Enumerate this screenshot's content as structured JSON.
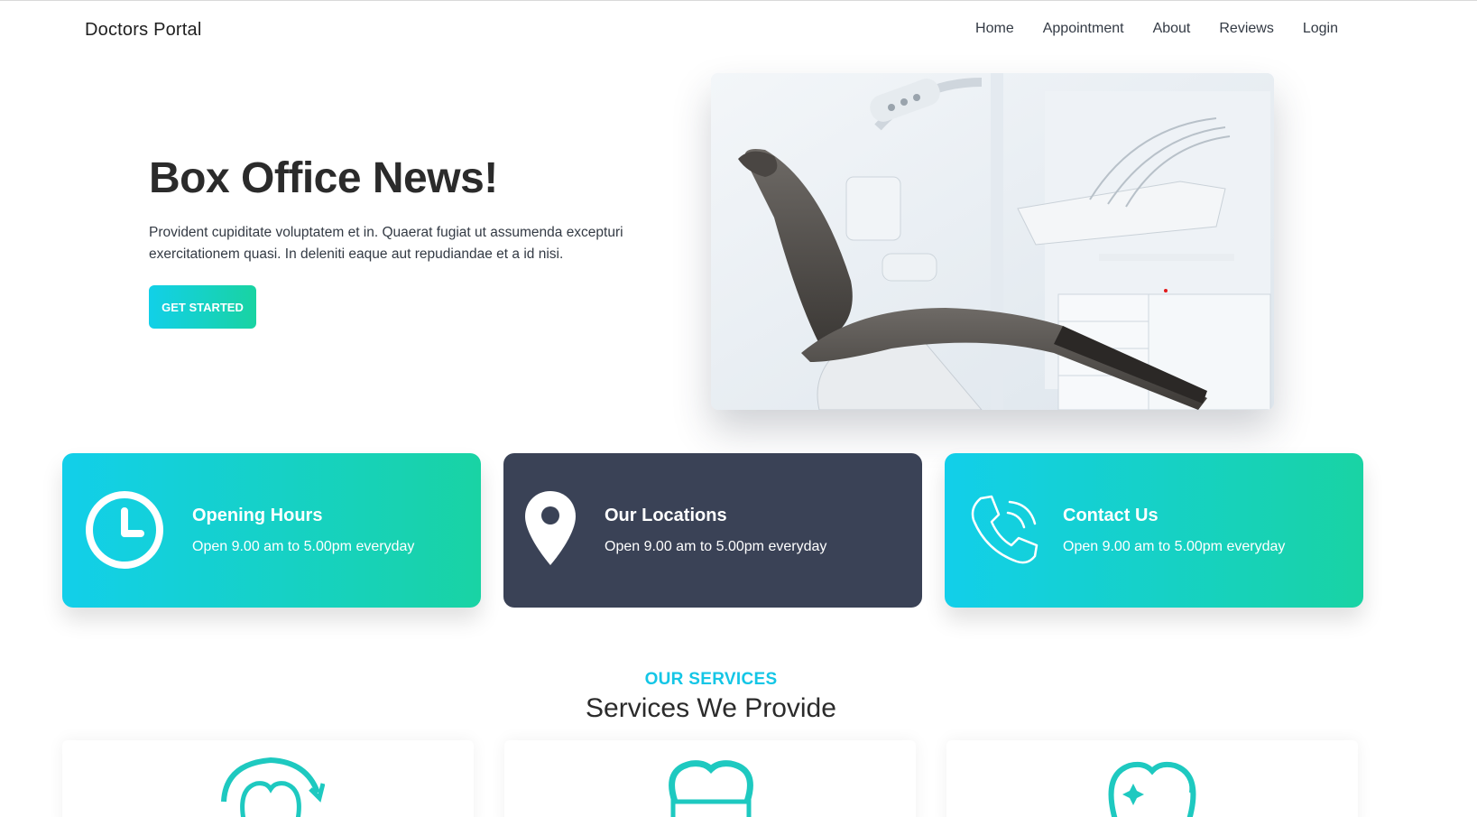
{
  "navbar": {
    "brand": "Doctors Portal",
    "links": [
      "Home",
      "Appointment",
      "About",
      "Reviews",
      "Login"
    ]
  },
  "hero": {
    "title": "Box Office News!",
    "text": "Provident cupiditate voluptatem et in. Quaerat fugiat ut assumenda excepturi exercitationem quasi. In deleniti eaque aut repudiandae et a id nisi.",
    "button": "GET STARTED"
  },
  "info_cards": [
    {
      "title": "Opening Hours",
      "subtitle": "Open 9.00 am to 5.00pm everyday",
      "icon": "clock-icon"
    },
    {
      "title": "Our Locations",
      "subtitle": "Open 9.00 am to 5.00pm everyday",
      "icon": "location-pin-icon"
    },
    {
      "title": "Contact Us",
      "subtitle": "Open 9.00 am to 5.00pm everyday",
      "icon": "phone-icon"
    }
  ],
  "services": {
    "kicker": "OUR SERVICES",
    "title": "Services We Provide",
    "icons": [
      "tooth-refresh-icon",
      "tooth-brace-icon",
      "tooth-sparkle-icon"
    ]
  },
  "colors": {
    "accent_start": "#12cfea",
    "accent_end": "#19d3a4",
    "dark_card": "#3a4256",
    "services_kicker": "#14c6e6"
  }
}
